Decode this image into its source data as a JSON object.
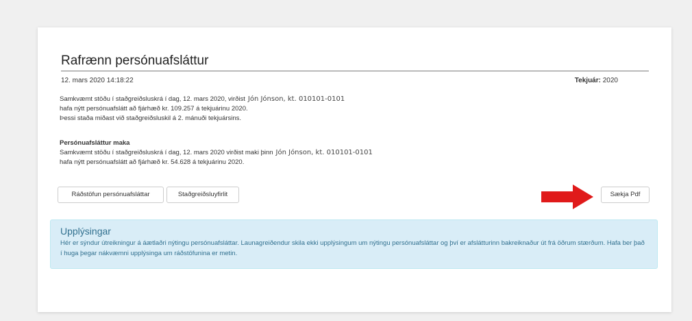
{
  "page": {
    "title": "Rafrænn persónuafsláttur",
    "date": "12. mars 2020 14:18:22",
    "year_label": "Tekjuár:",
    "year_value": "2020"
  },
  "section1": {
    "line1": "Samkvæmt stöðu í staðgreiðsluskrá í dag, 12. mars 2020, virðist",
    "person": "Jón Jónson, kt. 010101-0101",
    "line2": "hafa nýtt persónuafslátt að fjárhæð kr. 109.257 á tekjuárinu 2020.",
    "line3": "Þessi staða miðast við staðgreiðsluskil á 2. mánuði tekjuársins."
  },
  "section2": {
    "heading": "Persónuafsláttur maka",
    "line1": "Samkvæmt stöðu í staðgreiðsluskrá í dag, 12. mars 2020 virðist maki þinn",
    "person": "Jón Jónson, kt. 010101-0101",
    "line2": "hafa nýtt persónuafslátt að fjárhæð kr. 54.628 á tekjuárinu 2020."
  },
  "buttons": {
    "allocation": "Ráðstöfun persónuafsláttar",
    "summary": "Staðgreiðsluyfirlit",
    "pdf": "Sækja Pdf"
  },
  "info": {
    "heading": "Upplýsingar",
    "text": "Hér er sýndur útreikningur á áætlaðri nýtingu persónuafsláttar. Launagreiðendur skila ekki upplýsingum um nýtingu persónuafsláttar og því er afslátturinn bakreiknaður út frá öðrum stærðum. Hafa ber það í huga þegar nákvæmni upplýsinga um ráðstöfunina er metin."
  },
  "colors": {
    "arrow": "#e01a1a",
    "info_bg": "#d9edf7",
    "info_text": "#31708f"
  }
}
